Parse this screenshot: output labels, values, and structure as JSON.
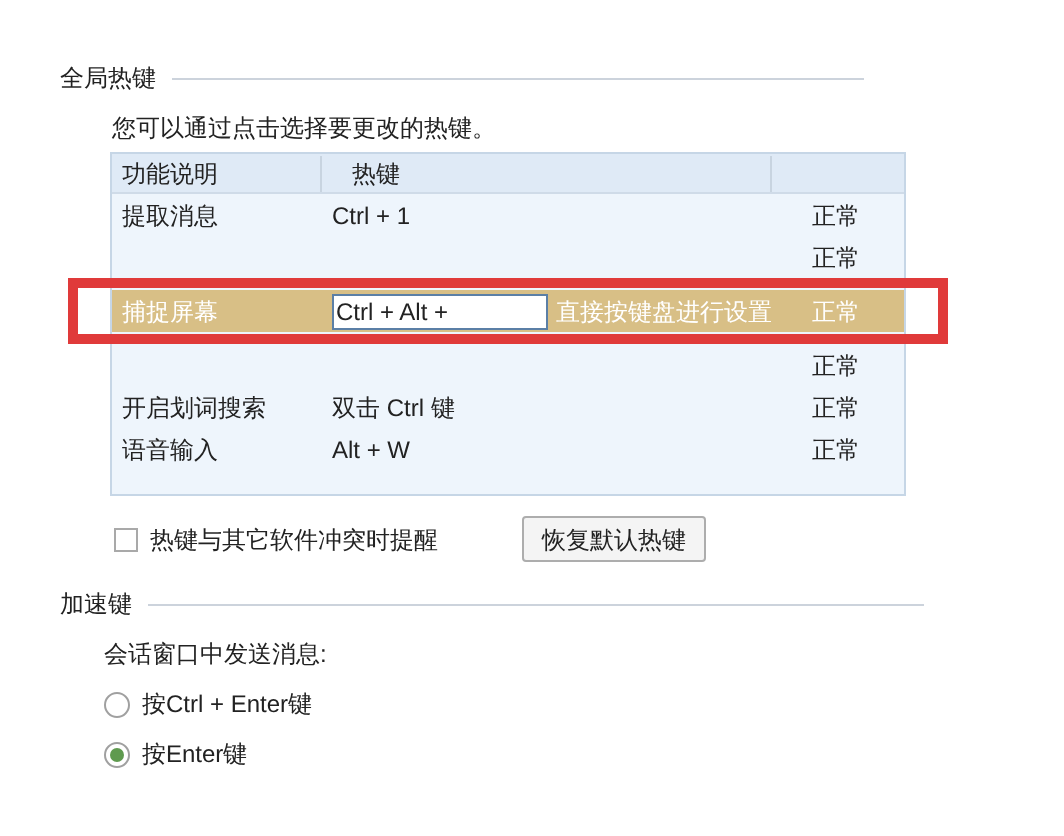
{
  "hotkeys": {
    "title": "全局热键",
    "instruction": "您可以通过点击选择要更改的热键。",
    "columns": [
      "功能说明",
      "热键"
    ],
    "rows": [
      {
        "name": "提取消息",
        "hotkey": "Ctrl + 1",
        "status": "正常",
        "selected": false
      },
      {
        "status": "正常",
        "selected": false
      },
      {
        "name": "捕捉屏幕",
        "hotkey": "Ctrl + Alt +",
        "hint": "直接按键盘进行设置",
        "status": "正常",
        "selected": true
      },
      {
        "status": "正常",
        "selected": false
      },
      {
        "name": "开启划词搜索",
        "hotkey": "双击 Ctrl 键",
        "status": "正常",
        "selected": false
      },
      {
        "name": "语音输入",
        "hotkey": "Alt + W",
        "status": "正常",
        "selected": false
      }
    ],
    "conflict_alert": {
      "label": "热键与其它软件冲突时提醒",
      "checked": false
    },
    "restore_button": "恢复默认热键"
  },
  "accelerator": {
    "title": "加速键",
    "prompt": "会话窗口中发送消息:",
    "options": [
      {
        "label": "按Ctrl + Enter键",
        "selected": false
      },
      {
        "label": "按Enter键",
        "selected": true
      }
    ]
  }
}
